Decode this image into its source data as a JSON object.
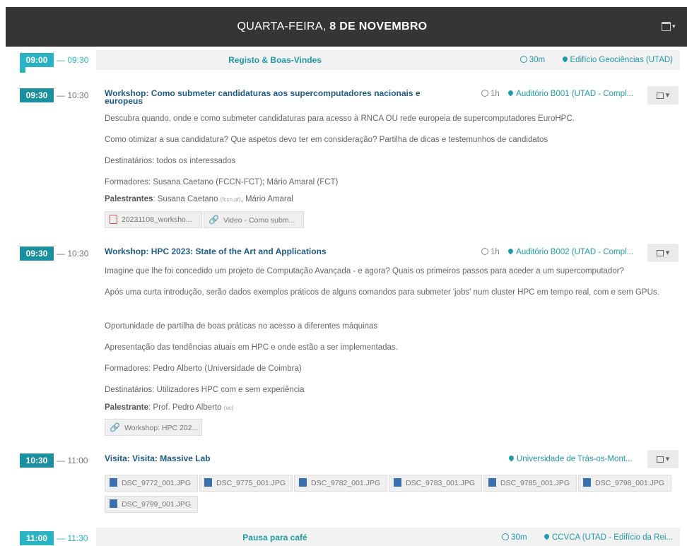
{
  "header": {
    "day": "QUARTA-FEIRA, ",
    "date": "8 DE NOVEMBRO",
    "calendar_icon": "calendar-icon",
    "caret": "▾"
  },
  "entries": [
    {
      "start": "09:00",
      "end": "— 09:30",
      "title": "Registo & Boas-Vindes",
      "duration": "30m",
      "location": "Edifício Geociências (UTAD)"
    },
    {
      "start": "09:30",
      "end": "— 10:30",
      "title": "Workshop: Como submeter candidaturas aos supercomputadores nacionais e europeus",
      "duration": "1h",
      "location": "Auditório B001 (UTAD - Compl...",
      "lines": [
        "Descubra quando, onde e como submeter candidaturas para acesso à RNCA OU rede europeia de supercomputadores EuroHPC.",
        "Como otimizar a sua candidatura? Que aspetos devo ter em consideração? Partilha de dicas e testemunhos de candidatos",
        "Destinatários: todos os interessados",
        "Formadores: Susana Caetano (FCCN-FCT); Mário Amaral (FCT)"
      ],
      "speakers_label": "Palestrantes",
      "speakers_a": ": Susana Caetano ",
      "speakers_aff": "(fccn.pt)",
      "speakers_b": ", Mário Amaral",
      "attachments": [
        "20231108_worksho...",
        "Video - Como subm..."
      ]
    },
    {
      "start": "09:30",
      "end": "— 10:30",
      "title": "Workshop: HPC 2023: State of the Art and Applications",
      "duration": "1h",
      "location": "Auditório B002 (UTAD - Compl...",
      "lines": [
        "Imagine que lhe foi concedido um projeto de Computação Avançada - e agora? Quais os primeiros passos para aceder a um supercomputador?",
        "Após uma curta introdução, serão dados exemplos práticos de alguns comandos para submeter 'jobs' num cluster HPC em tempo real, com e sem GPUs.",
        "Oportunidade de partilha de boas práticas no acesso a diferentes máquinas",
        "Apresentação das tendências atuais em HPC e onde estão a ser implementadas.",
        "Formadores: Pedro Alberto (Universidade de Coimbra)",
        "Destinatários: Utilizadores HPC com e sem experiência"
      ],
      "speakers_label": "Palestrante",
      "speakers_a": ": Prof. Pedro Alberto ",
      "speakers_aff": "(uc)",
      "attachments": [
        "Workshop: HPC 202..."
      ]
    },
    {
      "start": "10:30",
      "end": "— 11:00",
      "title": "Visita: Visita: Massive Lab",
      "location": "Universidade de Trás-os-Mont...",
      "attachments": [
        "DSC_9772_001.JPG",
        "DSC_9775_001.JPG",
        "DSC_9782_001.JPG",
        "DSC_9783_001.JPG",
        "DSC_9785_001.JPG",
        "DSC_9798_001.JPG",
        "DSC_9799_001.JPG"
      ]
    },
    {
      "start": "11:00",
      "end": "— 11:30",
      "title": "Pausa para café",
      "duration": "30m",
      "location": "CCVCA (UTAD - Edifício da Rei..."
    }
  ]
}
